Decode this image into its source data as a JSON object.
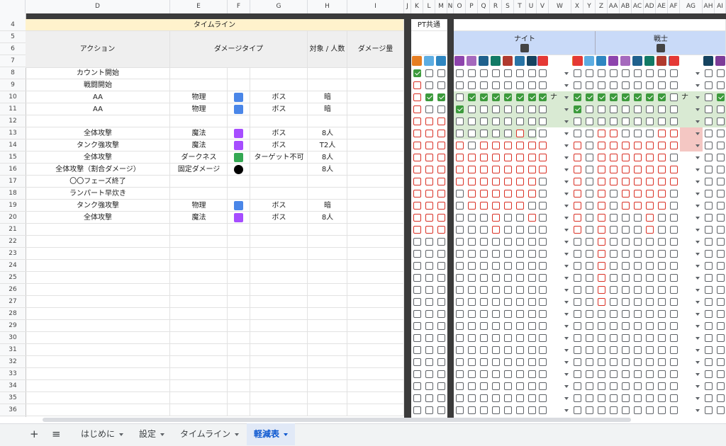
{
  "column_letters": [
    "D",
    "E",
    "F",
    "G",
    "H",
    "I",
    "J",
    "K",
    "L",
    "M",
    "N",
    "O",
    "P",
    "Q",
    "R",
    "S",
    "T",
    "U",
    "V",
    "W",
    "X",
    "Y",
    "Z",
    "AA",
    "AB",
    "AC",
    "AD",
    "AE",
    "AF",
    "AG",
    "AH",
    "AI"
  ],
  "header": {
    "timeline": "タイムライン",
    "action": "アクション",
    "damage_type": "ダメージタイプ",
    "target_count": "対象 / 人数",
    "damage_amount": "ダメージ量",
    "pt_common": "PT共通",
    "knight": "ナイト",
    "warrior": "戦士"
  },
  "row_numbers": [
    "4",
    "5",
    "6",
    "7",
    "8",
    "9",
    "10",
    "11",
    "12",
    "13",
    "14",
    "15",
    "16",
    "17",
    "18",
    "19",
    "20",
    "21",
    "22",
    "23",
    "24",
    "25",
    "26",
    "27",
    "28",
    "29",
    "30",
    "31",
    "32",
    "33",
    "34",
    "35",
    "36"
  ],
  "rows": [
    {
      "action": "カウント開始",
      "type": "",
      "target": "",
      "count": ""
    },
    {
      "action": "戦闘開始",
      "type": "",
      "target": "",
      "count": ""
    },
    {
      "action": "AA",
      "type": "物理",
      "target": "ボス",
      "count": "暗"
    },
    {
      "action": "AA",
      "type": "物理",
      "target": "ボス",
      "count": "暗"
    },
    {
      "action": "",
      "type": "",
      "target": "",
      "count": ""
    },
    {
      "action": "全体攻撃",
      "type": "魔法",
      "target": "ボス",
      "count": "8人"
    },
    {
      "action": "タンク強攻撃",
      "type": "魔法",
      "target": "ボス",
      "count": "T2人"
    },
    {
      "action": "全体攻撃",
      "type": "ダークネス",
      "target": "ターゲット不可",
      "count": "8人"
    },
    {
      "action": "全体攻撃（割合ダメージ）",
      "type": "固定ダメージ",
      "target": "",
      "count": "8人"
    },
    {
      "action": "〇〇フェーズ終了",
      "type": "",
      "target": "",
      "count": ""
    },
    {
      "action": "ランパート早炊き",
      "type": "",
      "target": "",
      "count": ""
    },
    {
      "action": "タンク強攻撃",
      "type": "物理",
      "target": "ボス",
      "count": "暗"
    },
    {
      "action": "全体攻撃",
      "type": "魔法",
      "target": "ボス",
      "count": "8人"
    }
  ],
  "dropdown_value_knight": "ナ",
  "dropdown_value_warrior": "ナ",
  "tabs": {
    "add": "+",
    "menu": "≡",
    "intro": "はじめに",
    "settings": "設定",
    "timeline": "タイムライン",
    "mitigation": "軽減表"
  },
  "colors": {
    "red": "#d93025",
    "green": "#3c9a3c",
    "header_yellow": "#fff2cc",
    "header_blue": "#c9daf8"
  }
}
